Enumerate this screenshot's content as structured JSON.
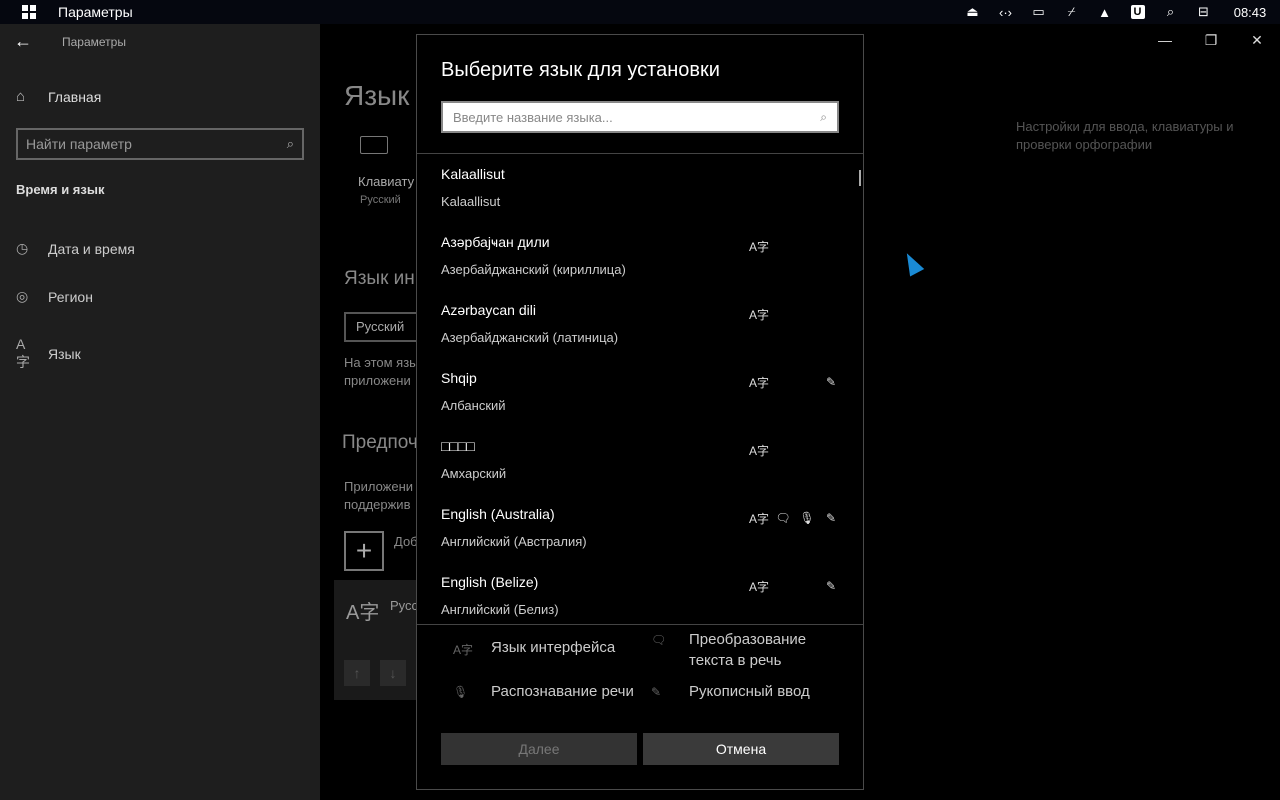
{
  "taskbar": {
    "app_title": "Параметры",
    "tray_icons": [
      "eject-icon",
      "code-brackets-icon",
      "monitor-icon",
      "no-wifi-icon",
      "triangle-up-icon",
      "u-badge-icon",
      "search-icon",
      "toggle-icon"
    ],
    "u_badge": "U",
    "clock": "08:43"
  },
  "window": {
    "title": "Параметры",
    "controls": [
      "minimize-icon",
      "restore-icon",
      "close-icon"
    ]
  },
  "sidebar": {
    "home_label": "Главная",
    "search_placeholder": "Найти параметр",
    "group_title": "Время и язык",
    "items": [
      {
        "label": "Дата и время",
        "icon": "calendar-clock-icon"
      },
      {
        "label": "Регион",
        "icon": "globe-icon"
      },
      {
        "label": "Язык",
        "icon": "language-icon"
      }
    ]
  },
  "content": {
    "title": "Язык",
    "keyboard_label": "Клавиату",
    "keyboard_sub": "Русский",
    "right_link": "Настройки для ввода, клавиатуры и проверки орфографии",
    "section_interface": "Язык ин",
    "interface_lang": "Русский",
    "para1": [
      "На этом язы",
      "приложени"
    ],
    "section_preferred": "Предпоч",
    "para2": [
      "Приложени",
      "поддержив"
    ],
    "add_label": "Доб",
    "preferred_lang": "Русс",
    "preferred_glyph": "A字"
  },
  "dialog": {
    "title": "Выберите язык для установки",
    "search_placeholder": "Введите название языка...",
    "languages": [
      {
        "native": "Kalaallisut",
        "local": "Kalaallisut",
        "caps": {
          "display": false,
          "tts": false,
          "speech": false,
          "handwriting": false
        }
      },
      {
        "native": "Азәрбајҹан дили",
        "local": "Азербайджанский (кириллица)",
        "caps": {
          "display": true,
          "tts": false,
          "speech": false,
          "handwriting": false
        }
      },
      {
        "native": "Azərbaycan dili",
        "local": "Азербайджанский (латиница)",
        "caps": {
          "display": true,
          "tts": false,
          "speech": false,
          "handwriting": false
        }
      },
      {
        "native": "Shqip",
        "local": "Албанский",
        "caps": {
          "display": true,
          "tts": false,
          "speech": false,
          "handwriting": true
        }
      },
      {
        "native": "□□□□",
        "local": "Амхарский",
        "caps": {
          "display": true,
          "tts": false,
          "speech": false,
          "handwriting": false
        }
      },
      {
        "native": "English (Australia)",
        "local": "Английский (Австралия)",
        "caps": {
          "display": true,
          "tts": true,
          "speech": true,
          "handwriting": true
        }
      },
      {
        "native": "English (Belize)",
        "local": "Английский (Белиз)",
        "caps": {
          "display": true,
          "tts": false,
          "speech": false,
          "handwriting": true
        }
      }
    ],
    "legend": {
      "display": "Язык интерфейса",
      "tts": "Преобразование текста в речь",
      "speech": "Распознавание речи",
      "handwriting": "Рукописный ввод"
    },
    "next_label": "Далее",
    "cancel_label": "Отмена"
  }
}
